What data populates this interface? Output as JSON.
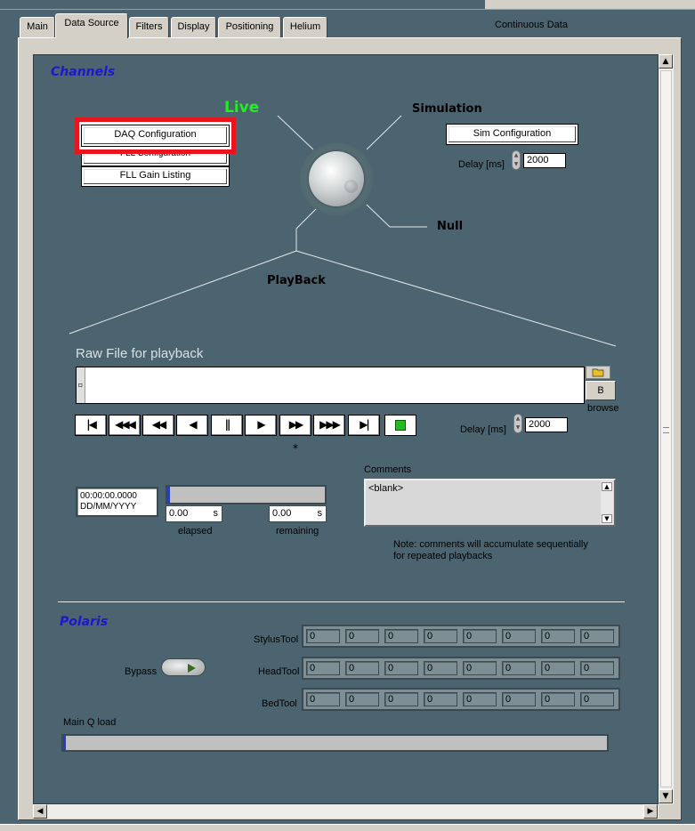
{
  "tabs": [
    {
      "label": "Main"
    },
    {
      "label": "Data Source"
    },
    {
      "label": "Filters"
    },
    {
      "label": "Display"
    },
    {
      "label": "Positioning"
    },
    {
      "label": "Helium"
    }
  ],
  "window_title": "Continuous Data",
  "channels": {
    "title": "Channels",
    "daq_button": "DAQ Configuration",
    "fll_config_button": "FLL Configuration",
    "fll_gain_button": "FLL Gain Listing",
    "sim_button": "Sim Configuration",
    "live_label": "Live",
    "simulation_label": "Simulation",
    "null_label": "Null",
    "playback_label": "PlayBack",
    "sim_delay_label": "Delay [ms]",
    "sim_delay_value": "2000"
  },
  "playback": {
    "raw_file_label": "Raw File for playback",
    "file_path_value": "",
    "browse_button": "B",
    "browse_label": "browse",
    "delay_label": "Delay [ms]",
    "delay_value": "2000",
    "asterisk": "*",
    "timestamp_line1": "00:00:00.0000",
    "timestamp_line2": "DD/MM/YYYY",
    "elapsed_value": "0.00",
    "elapsed_unit": "s",
    "elapsed_label": "elapsed",
    "remaining_value": "0.00",
    "remaining_unit": "s",
    "remaining_label": "remaining",
    "progress_fraction": 0.0,
    "comments_label": "Comments",
    "comments_value": "<blank>",
    "note_line1": "Note: comments will accumulate sequentially",
    "note_line2": "for repeated playbacks"
  },
  "transport_buttons": [
    {
      "glyph": "|◀",
      "name": "go-to-start"
    },
    {
      "glyph": "◀◀◀",
      "name": "fast-rewind"
    },
    {
      "glyph": "◀◀",
      "name": "rewind"
    },
    {
      "glyph": "◀",
      "name": "step-back"
    },
    {
      "glyph": "||",
      "name": "pause"
    },
    {
      "glyph": "▶",
      "name": "play"
    },
    {
      "glyph": "▶▶",
      "name": "fast-forward"
    },
    {
      "glyph": "▶▶▶",
      "name": "faster-forward"
    },
    {
      "glyph": "▶|",
      "name": "go-to-end"
    }
  ],
  "polaris": {
    "title": "Polaris",
    "bypass_label": "Bypass",
    "stylus_label": "StylusTool",
    "head_label": "HeadTool",
    "bed_label": "BedTool",
    "stylus_values": [
      "0",
      "0",
      "0",
      "0",
      "0",
      "0",
      "0",
      "0"
    ],
    "head_values": [
      "0",
      "0",
      "0",
      "0",
      "0",
      "0",
      "0",
      "0"
    ],
    "bed_values": [
      "0",
      "0",
      "0",
      "0",
      "0",
      "0",
      "0",
      "0"
    ],
    "main_q_label": "Main Q load",
    "main_q_fraction": 0.0
  },
  "colors": {
    "panel": "#4c6470",
    "section_title": "#1a1acc",
    "live": "#22ee22",
    "highlight": "#e8141e",
    "stop_led": "#22bb22"
  }
}
